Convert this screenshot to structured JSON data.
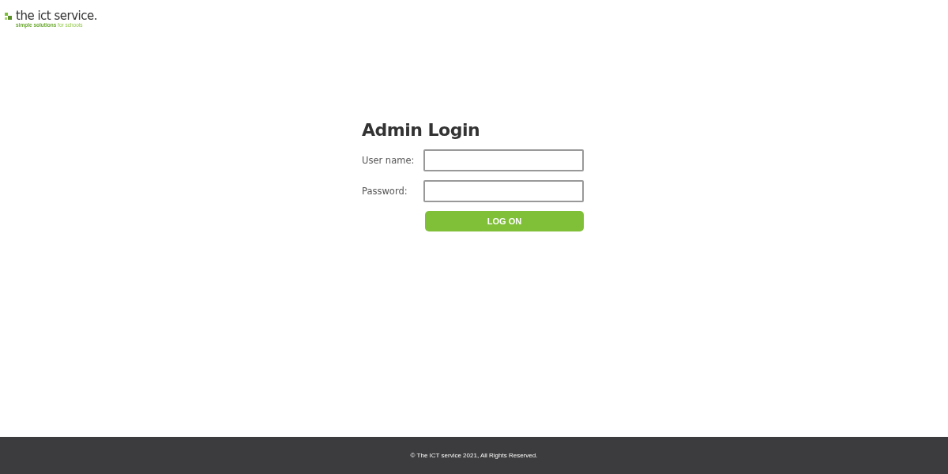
{
  "logo": {
    "name": "the ict service.",
    "tagline": "**simple solutions** for schools"
  },
  "form": {
    "title": "Admin Login",
    "fields": [
      {
        "label": "User name:"
      },
      {
        "label": "Password:"
      }
    ],
    "button": "LOG ON"
  },
  "footer": "© The ICT service 2021, All Rights Reserved."
}
